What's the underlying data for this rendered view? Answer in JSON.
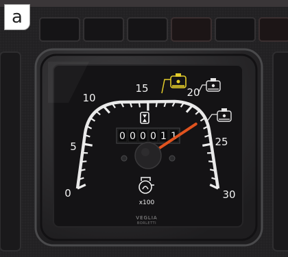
{
  "panel_label": "a",
  "dial": {
    "major_labels": [
      "0",
      "5",
      "10",
      "15",
      "20",
      "25",
      "30"
    ],
    "icon_multiplier": "x100",
    "brand": "VEGLIA",
    "brand_sub": "BORLETTI"
  },
  "odometer": {
    "digits": [
      "0",
      "0",
      "0",
      "0",
      "1",
      "1"
    ]
  },
  "needle": {
    "reading": 22,
    "color": "#e0531f"
  },
  "warning_badge": {
    "color": "#e3cc2a"
  }
}
